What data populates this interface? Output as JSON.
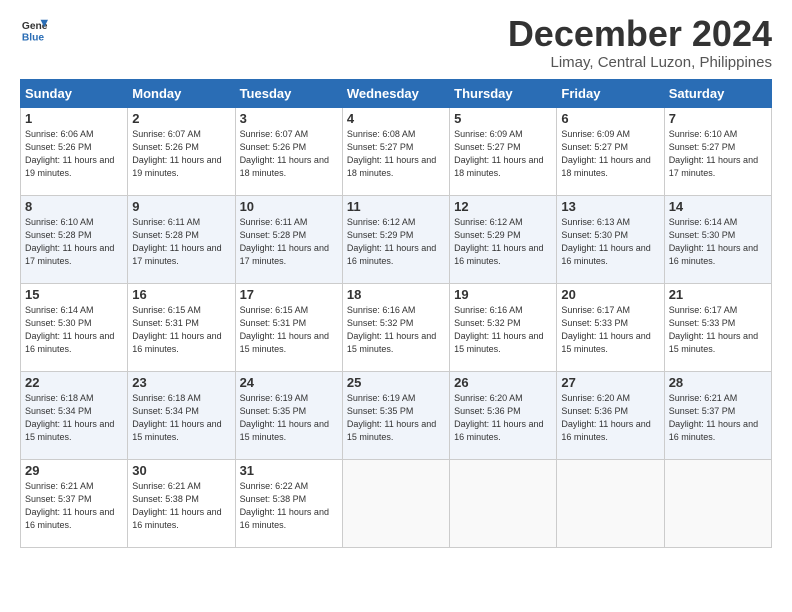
{
  "logo": {
    "line1": "General",
    "line2": "Blue"
  },
  "title": "December 2024",
  "location": "Limay, Central Luzon, Philippines",
  "days_of_week": [
    "Sunday",
    "Monday",
    "Tuesday",
    "Wednesday",
    "Thursday",
    "Friday",
    "Saturday"
  ],
  "weeks": [
    [
      {
        "day": "1",
        "sunrise": "6:06 AM",
        "sunset": "5:26 PM",
        "daylight": "11 hours and 19 minutes."
      },
      {
        "day": "2",
        "sunrise": "6:07 AM",
        "sunset": "5:26 PM",
        "daylight": "11 hours and 19 minutes."
      },
      {
        "day": "3",
        "sunrise": "6:07 AM",
        "sunset": "5:26 PM",
        "daylight": "11 hours and 18 minutes."
      },
      {
        "day": "4",
        "sunrise": "6:08 AM",
        "sunset": "5:27 PM",
        "daylight": "11 hours and 18 minutes."
      },
      {
        "day": "5",
        "sunrise": "6:09 AM",
        "sunset": "5:27 PM",
        "daylight": "11 hours and 18 minutes."
      },
      {
        "day": "6",
        "sunrise": "6:09 AM",
        "sunset": "5:27 PM",
        "daylight": "11 hours and 18 minutes."
      },
      {
        "day": "7",
        "sunrise": "6:10 AM",
        "sunset": "5:27 PM",
        "daylight": "11 hours and 17 minutes."
      }
    ],
    [
      {
        "day": "8",
        "sunrise": "6:10 AM",
        "sunset": "5:28 PM",
        "daylight": "11 hours and 17 minutes."
      },
      {
        "day": "9",
        "sunrise": "6:11 AM",
        "sunset": "5:28 PM",
        "daylight": "11 hours and 17 minutes."
      },
      {
        "day": "10",
        "sunrise": "6:11 AM",
        "sunset": "5:28 PM",
        "daylight": "11 hours and 17 minutes."
      },
      {
        "day": "11",
        "sunrise": "6:12 AM",
        "sunset": "5:29 PM",
        "daylight": "11 hours and 16 minutes."
      },
      {
        "day": "12",
        "sunrise": "6:12 AM",
        "sunset": "5:29 PM",
        "daylight": "11 hours and 16 minutes."
      },
      {
        "day": "13",
        "sunrise": "6:13 AM",
        "sunset": "5:30 PM",
        "daylight": "11 hours and 16 minutes."
      },
      {
        "day": "14",
        "sunrise": "6:14 AM",
        "sunset": "5:30 PM",
        "daylight": "11 hours and 16 minutes."
      }
    ],
    [
      {
        "day": "15",
        "sunrise": "6:14 AM",
        "sunset": "5:30 PM",
        "daylight": "11 hours and 16 minutes."
      },
      {
        "day": "16",
        "sunrise": "6:15 AM",
        "sunset": "5:31 PM",
        "daylight": "11 hours and 16 minutes."
      },
      {
        "day": "17",
        "sunrise": "6:15 AM",
        "sunset": "5:31 PM",
        "daylight": "11 hours and 15 minutes."
      },
      {
        "day": "18",
        "sunrise": "6:16 AM",
        "sunset": "5:32 PM",
        "daylight": "11 hours and 15 minutes."
      },
      {
        "day": "19",
        "sunrise": "6:16 AM",
        "sunset": "5:32 PM",
        "daylight": "11 hours and 15 minutes."
      },
      {
        "day": "20",
        "sunrise": "6:17 AM",
        "sunset": "5:33 PM",
        "daylight": "11 hours and 15 minutes."
      },
      {
        "day": "21",
        "sunrise": "6:17 AM",
        "sunset": "5:33 PM",
        "daylight": "11 hours and 15 minutes."
      }
    ],
    [
      {
        "day": "22",
        "sunrise": "6:18 AM",
        "sunset": "5:34 PM",
        "daylight": "11 hours and 15 minutes."
      },
      {
        "day": "23",
        "sunrise": "6:18 AM",
        "sunset": "5:34 PM",
        "daylight": "11 hours and 15 minutes."
      },
      {
        "day": "24",
        "sunrise": "6:19 AM",
        "sunset": "5:35 PM",
        "daylight": "11 hours and 15 minutes."
      },
      {
        "day": "25",
        "sunrise": "6:19 AM",
        "sunset": "5:35 PM",
        "daylight": "11 hours and 15 minutes."
      },
      {
        "day": "26",
        "sunrise": "6:20 AM",
        "sunset": "5:36 PM",
        "daylight": "11 hours and 16 minutes."
      },
      {
        "day": "27",
        "sunrise": "6:20 AM",
        "sunset": "5:36 PM",
        "daylight": "11 hours and 16 minutes."
      },
      {
        "day": "28",
        "sunrise": "6:21 AM",
        "sunset": "5:37 PM",
        "daylight": "11 hours and 16 minutes."
      }
    ],
    [
      {
        "day": "29",
        "sunrise": "6:21 AM",
        "sunset": "5:37 PM",
        "daylight": "11 hours and 16 minutes."
      },
      {
        "day": "30",
        "sunrise": "6:21 AM",
        "sunset": "5:38 PM",
        "daylight": "11 hours and 16 minutes."
      },
      {
        "day": "31",
        "sunrise": "6:22 AM",
        "sunset": "5:38 PM",
        "daylight": "11 hours and 16 minutes."
      },
      null,
      null,
      null,
      null
    ]
  ]
}
